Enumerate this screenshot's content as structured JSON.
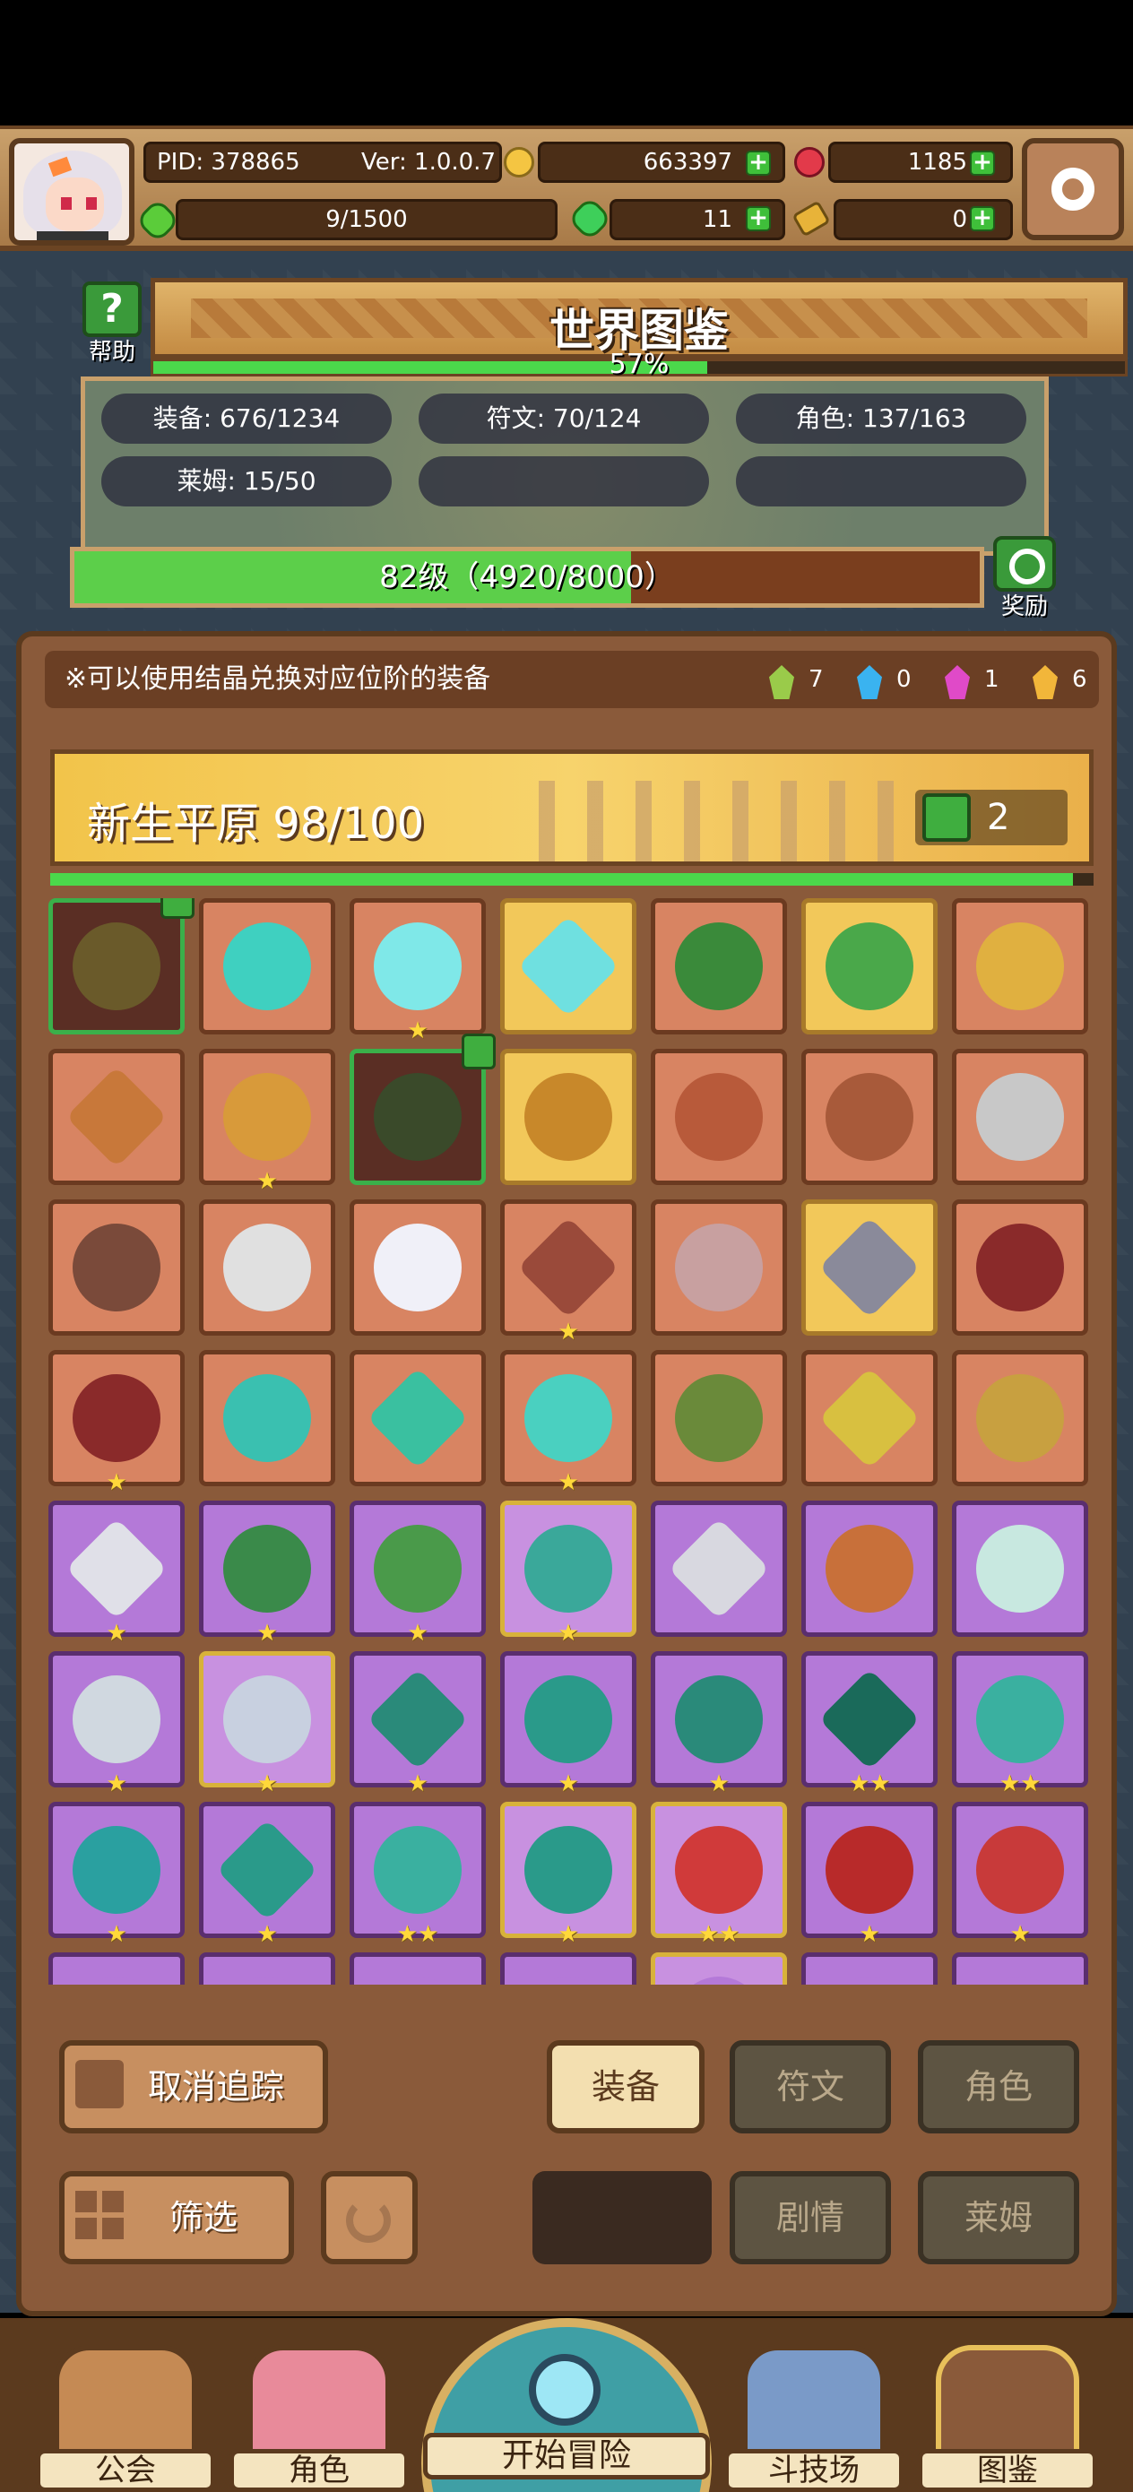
{
  "header": {
    "pid": "PID: 378865",
    "version": "Ver: 1.0.0.7",
    "gold": "663397",
    "gems": "1185",
    "stamina": "9/1500",
    "clover": "11",
    "keys": "0"
  },
  "codex": {
    "title": "世界图鉴",
    "help_label": "帮助",
    "percent": "57%",
    "percent_value": 0.57,
    "stats": {
      "equipment": "装备: 676/1234",
      "runes": "符文: 70/124",
      "characters": "角色: 137/163",
      "slimes": "莱姆: 15/50"
    },
    "level_text": "82级（4920/8000）",
    "level_progress": 0.615,
    "reward_label": "奖励"
  },
  "notice": "※可以使用结晶兑换对应位阶的装备",
  "crystals": [
    {
      "color": "#9acb4a",
      "count": "7"
    },
    {
      "color": "#3ab3f0",
      "count": "0"
    },
    {
      "color": "#e04ac8",
      "count": "1"
    },
    {
      "color": "#f2b63a",
      "count": "6"
    }
  ],
  "area": {
    "name": "新生平原 98/100",
    "likes": "2",
    "progress": 0.98
  },
  "grid_items": [
    {
      "bg": "orange",
      "variant": "dark",
      "color": "#6a5a2a",
      "shape": "round",
      "stars": "",
      "thumb": true
    },
    {
      "bg": "orange",
      "variant": "",
      "color": "#3fd0c0",
      "shape": "round",
      "stars": "",
      "thumb": false
    },
    {
      "bg": "orange",
      "variant": "",
      "color": "#7fe8e8",
      "shape": "round",
      "stars": "★",
      "thumb": false
    },
    {
      "bg": "orange",
      "variant": "gold",
      "color": "#6fe0e0",
      "shape": "sq",
      "stars": "",
      "thumb": false
    },
    {
      "bg": "orange",
      "variant": "",
      "color": "#3a8a3a",
      "shape": "round",
      "stars": "",
      "thumb": false
    },
    {
      "bg": "orange",
      "variant": "gold",
      "color": "#4aa84a",
      "shape": "round",
      "stars": "",
      "thumb": false
    },
    {
      "bg": "orange",
      "variant": "",
      "color": "#e0b040",
      "shape": "round",
      "stars": "",
      "thumb": false
    },
    {
      "bg": "orange",
      "variant": "",
      "color": "#c8783a",
      "shape": "sq",
      "stars": "",
      "thumb": false
    },
    {
      "bg": "orange",
      "variant": "",
      "color": "#d89a3a",
      "shape": "round",
      "stars": "★",
      "thumb": false
    },
    {
      "bg": "orange",
      "variant": "dark",
      "color": "#3a4a2a",
      "shape": "round",
      "stars": "",
      "thumb": true
    },
    {
      "bg": "orange",
      "variant": "gold",
      "color": "#c8882a",
      "shape": "round",
      "stars": "",
      "thumb": false
    },
    {
      "bg": "orange",
      "variant": "",
      "color": "#b85a3a",
      "shape": "round",
      "stars": "",
      "thumb": false
    },
    {
      "bg": "orange",
      "variant": "",
      "color": "#a85a3a",
      "shape": "round",
      "stars": "",
      "thumb": false
    },
    {
      "bg": "orange",
      "variant": "",
      "color": "#c8c8c8",
      "shape": "round",
      "stars": "",
      "thumb": false
    },
    {
      "bg": "orange",
      "variant": "",
      "color": "#7a4a3a",
      "shape": "round",
      "stars": "",
      "thumb": false
    },
    {
      "bg": "orange",
      "variant": "",
      "color": "#e0e0e0",
      "shape": "round",
      "stars": "",
      "thumb": false
    },
    {
      "bg": "orange",
      "variant": "",
      "color": "#f0f0f8",
      "shape": "round",
      "stars": "",
      "thumb": false
    },
    {
      "bg": "orange",
      "variant": "",
      "color": "#9a4a3a",
      "shape": "sq",
      "stars": "★",
      "thumb": false
    },
    {
      "bg": "orange",
      "variant": "",
      "color": "#c8a0a0",
      "shape": "round",
      "stars": "",
      "thumb": false
    },
    {
      "bg": "orange",
      "variant": "gold",
      "color": "#8a8a9a",
      "shape": "sq",
      "stars": "",
      "thumb": false
    },
    {
      "bg": "orange",
      "variant": "",
      "color": "#8a2a2a",
      "shape": "round",
      "stars": "",
      "thumb": false
    },
    {
      "bg": "orange",
      "variant": "",
      "color": "#8a2a2a",
      "shape": "round",
      "stars": "★",
      "thumb": false
    },
    {
      "bg": "orange",
      "variant": "",
      "color": "#3ac0b0",
      "shape": "round",
      "stars": "",
      "thumb": false
    },
    {
      "bg": "orange",
      "variant": "",
      "color": "#3ac0a0",
      "shape": "sq",
      "stars": "",
      "thumb": false
    },
    {
      "bg": "orange",
      "variant": "",
      "color": "#4ad0c0",
      "shape": "round",
      "stars": "★",
      "thumb": false
    },
    {
      "bg": "orange",
      "variant": "",
      "color": "#6a8a3a",
      "shape": "round",
      "stars": "",
      "thumb": false
    },
    {
      "bg": "orange",
      "variant": "",
      "color": "#d8c040",
      "shape": "sq",
      "stars": "",
      "thumb": false
    },
    {
      "bg": "orange",
      "variant": "",
      "color": "#c8a040",
      "shape": "round",
      "stars": "",
      "thumb": false
    },
    {
      "bg": "purple",
      "variant": "",
      "color": "#e0e0e8",
      "shape": "sq",
      "stars": "★",
      "thumb": false
    },
    {
      "bg": "purple",
      "variant": "",
      "color": "#3a8a4a",
      "shape": "round",
      "stars": "★",
      "thumb": false
    },
    {
      "bg": "purple",
      "variant": "",
      "color": "#4a9a4a",
      "shape": "round",
      "stars": "★",
      "thumb": false
    },
    {
      "bg": "purple",
      "variant": "gold",
      "color": "#3aa89a",
      "shape": "round",
      "stars": "★",
      "thumb": false
    },
    {
      "bg": "purple",
      "variant": "",
      "color": "#d8d8e0",
      "shape": "sq",
      "stars": "",
      "thumb": false
    },
    {
      "bg": "purple",
      "variant": "",
      "color": "#c8703a",
      "shape": "round",
      "stars": "",
      "thumb": false
    },
    {
      "bg": "purple",
      "variant": "",
      "color": "#c8e8e0",
      "shape": "round",
      "stars": "",
      "thumb": false
    },
    {
      "bg": "purple",
      "variant": "",
      "color": "#d0d8e0",
      "shape": "round",
      "stars": "★",
      "thumb": false
    },
    {
      "bg": "purple",
      "variant": "gold",
      "color": "#c8d0e0",
      "shape": "round",
      "stars": "★",
      "thumb": false
    },
    {
      "bg": "purple",
      "variant": "",
      "color": "#2a8a7a",
      "shape": "sq",
      "stars": "★",
      "thumb": false
    },
    {
      "bg": "purple",
      "variant": "",
      "color": "#2a9a8a",
      "shape": "round",
      "stars": "★",
      "thumb": false
    },
    {
      "bg": "purple",
      "variant": "",
      "color": "#2a8a7a",
      "shape": "round",
      "stars": "★",
      "thumb": false
    },
    {
      "bg": "purple",
      "variant": "",
      "color": "#1a6a5a",
      "shape": "sq",
      "stars": "★★",
      "thumb": false
    },
    {
      "bg": "purple",
      "variant": "",
      "color": "#3ab0a0",
      "shape": "round",
      "stars": "★★",
      "thumb": false
    },
    {
      "bg": "purple",
      "variant": "",
      "color": "#2aa0a0",
      "shape": "round",
      "stars": "★",
      "thumb": false
    },
    {
      "bg": "purple",
      "variant": "",
      "color": "#2a9a8a",
      "shape": "sq",
      "stars": "★",
      "thumb": false
    },
    {
      "bg": "purple",
      "variant": "",
      "color": "#3ab0a0",
      "shape": "round",
      "stars": "★★",
      "thumb": false
    },
    {
      "bg": "purple",
      "variant": "gold",
      "color": "#2a9a8a",
      "shape": "round",
      "stars": "★",
      "thumb": false
    },
    {
      "bg": "purple",
      "variant": "gold",
      "color": "#d03a3a",
      "shape": "round",
      "stars": "★★",
      "thumb": false
    },
    {
      "bg": "purple",
      "variant": "",
      "color": "#b82a2a",
      "shape": "round",
      "stars": "★",
      "thumb": false
    },
    {
      "bg": "purple",
      "variant": "",
      "color": "#c83a3a",
      "shape": "round",
      "stars": "★",
      "thumb": false
    },
    {
      "bg": "purple",
      "variant": "",
      "color": "#b479d8",
      "shape": "round",
      "stars": "",
      "thumb": false
    },
    {
      "bg": "purple",
      "variant": "",
      "color": "#b479d8",
      "shape": "round",
      "stars": "",
      "thumb": false
    },
    {
      "bg": "purple",
      "variant": "",
      "color": "#b479d8",
      "shape": "round",
      "stars": "",
      "thumb": false
    },
    {
      "bg": "purple",
      "variant": "",
      "color": "#b479d8",
      "shape": "round",
      "stars": "",
      "thumb": false
    },
    {
      "bg": "purple",
      "variant": "gold",
      "color": "#b479d8",
      "shape": "round",
      "stars": "",
      "thumb": false
    },
    {
      "bg": "purple",
      "variant": "",
      "color": "#b479d8",
      "shape": "round",
      "stars": "",
      "thumb": false
    },
    {
      "bg": "purple",
      "variant": "",
      "color": "#b479d8",
      "shape": "round",
      "stars": "",
      "thumb": false
    }
  ],
  "controls": {
    "untrack": "取消追踪",
    "filter": "筛选",
    "tab_equipment": "装备",
    "tab_runes": "符文",
    "tab_characters": "角色",
    "tab_story": "剧情",
    "tab_slimes": "莱姆"
  },
  "nav": {
    "guild": "公会",
    "characters": "角色",
    "start": "开始冒险",
    "arena": "斗技场",
    "codex": "图鉴"
  }
}
